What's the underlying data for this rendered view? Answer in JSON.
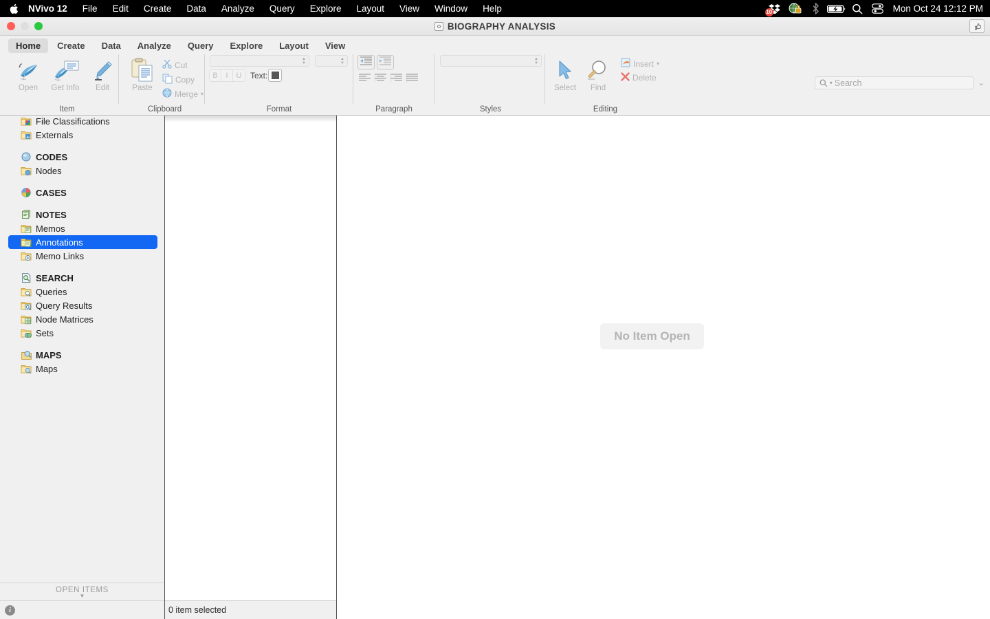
{
  "menubar": {
    "apple_icon": "apple-icon",
    "app_name": "NVivo 12",
    "items": [
      "File",
      "Edit",
      "Create",
      "Data",
      "Analyze",
      "Query",
      "Explore",
      "Layout",
      "View",
      "Window",
      "Help"
    ],
    "status": {
      "dropbox_badge": "10",
      "icons": [
        "dropbox-icon",
        "vpn-lock-icon",
        "bluetooth-icon",
        "battery-charging-icon",
        "spotlight-search-icon",
        "control-center-icon"
      ],
      "clock": "Mon Oct 24  12:12 PM"
    }
  },
  "window": {
    "title": "BIOGRAPHY ANALYSIS",
    "traffic_lights": [
      "close",
      "minimize",
      "zoom"
    ]
  },
  "ribbon": {
    "tabs": [
      {
        "label": "Home",
        "active": true
      },
      {
        "label": "Create",
        "active": false
      },
      {
        "label": "Data",
        "active": false
      },
      {
        "label": "Analyze",
        "active": false
      },
      {
        "label": "Query",
        "active": false
      },
      {
        "label": "Explore",
        "active": false
      },
      {
        "label": "Layout",
        "active": false
      },
      {
        "label": "View",
        "active": false
      }
    ],
    "search": {
      "placeholder": "Search",
      "value": ""
    },
    "groups": {
      "item": {
        "label": "Item",
        "buttons": [
          {
            "label": "Open",
            "icon": "open-item-icon"
          },
          {
            "label": "Get Info",
            "icon": "get-info-icon"
          },
          {
            "label": "Edit",
            "icon": "edit-pencil-icon"
          }
        ]
      },
      "clipboard": {
        "label": "Clipboard",
        "paste": {
          "label": "Paste",
          "icon": "paste-icon"
        },
        "commands": [
          {
            "label": "Cut",
            "icon": "scissors-icon"
          },
          {
            "label": "Copy",
            "icon": "copy-icon"
          },
          {
            "label": "Merge",
            "icon": "merge-icon"
          }
        ]
      },
      "format": {
        "label": "Format",
        "font_value": "",
        "size_value": "",
        "bold": "B",
        "italic": "I",
        "underline": "U",
        "text_label": "Text:",
        "text_color": "#555555"
      },
      "paragraph": {
        "label": "Paragraph",
        "indent_buttons": [
          "decrease-indent-icon",
          "increase-indent-icon"
        ],
        "align_buttons": [
          "align-left-icon",
          "align-center-icon",
          "align-right-icon",
          "align-justify-icon"
        ]
      },
      "styles": {
        "label": "Styles",
        "value": ""
      },
      "editing": {
        "label": "Editing",
        "buttons": [
          {
            "label": "Select",
            "icon": "cursor-arrow-icon"
          },
          {
            "label": "Find",
            "icon": "magnifier-icon"
          }
        ],
        "commands": [
          {
            "label": "Insert",
            "icon": "insert-icon"
          },
          {
            "label": "Delete",
            "icon": "delete-x-icon"
          }
        ]
      }
    }
  },
  "sidebar": {
    "rows": [
      {
        "label": "File Classifications",
        "icon": "file-classifications-folder-icon",
        "type": "item",
        "selected": false
      },
      {
        "label": "Externals",
        "icon": "externals-folder-icon",
        "type": "item",
        "selected": false
      },
      {
        "label": "",
        "type": "spacer"
      },
      {
        "label": "CODES",
        "icon": "codes-sphere-icon",
        "type": "header",
        "selected": false
      },
      {
        "label": "Nodes",
        "icon": "nodes-folder-icon",
        "type": "item",
        "selected": false
      },
      {
        "label": "",
        "type": "spacer"
      },
      {
        "label": "CASES",
        "icon": "cases-pie-icon",
        "type": "header",
        "selected": false
      },
      {
        "label": "",
        "type": "spacer"
      },
      {
        "label": "NOTES",
        "icon": "notes-stack-icon",
        "type": "header",
        "selected": false
      },
      {
        "label": "Memos",
        "icon": "memos-folder-icon",
        "type": "item",
        "selected": false
      },
      {
        "label": "Annotations",
        "icon": "annotations-folder-icon",
        "type": "item",
        "selected": true
      },
      {
        "label": "Memo Links",
        "icon": "memo-links-folder-icon",
        "type": "item",
        "selected": false
      },
      {
        "label": "",
        "type": "spacer"
      },
      {
        "label": "SEARCH",
        "icon": "search-page-icon",
        "type": "header",
        "selected": false
      },
      {
        "label": "Queries",
        "icon": "queries-folder-icon",
        "type": "item",
        "selected": false
      },
      {
        "label": "Query Results",
        "icon": "query-results-folder-icon",
        "type": "item",
        "selected": false
      },
      {
        "label": "Node Matrices",
        "icon": "node-matrices-folder-icon",
        "type": "item",
        "selected": false
      },
      {
        "label": "Sets",
        "icon": "sets-folder-icon",
        "type": "item",
        "selected": false
      },
      {
        "label": "",
        "type": "spacer"
      },
      {
        "label": "MAPS",
        "icon": "maps-icon",
        "type": "header",
        "selected": false
      },
      {
        "label": "Maps",
        "icon": "maps-folder-icon",
        "type": "item",
        "selected": false
      }
    ],
    "open_items_label": "OPEN ITEMS",
    "info_icon": "info-icon"
  },
  "list_panel": {
    "status_text": "0 item selected",
    "rows": []
  },
  "detail": {
    "placeholder": "No Item Open"
  },
  "colors": {
    "selection_blue": "#1268f3",
    "menubar_black": "#000000",
    "chrome_gray": "#f0f0f0",
    "badge_red": "#e8453c"
  }
}
